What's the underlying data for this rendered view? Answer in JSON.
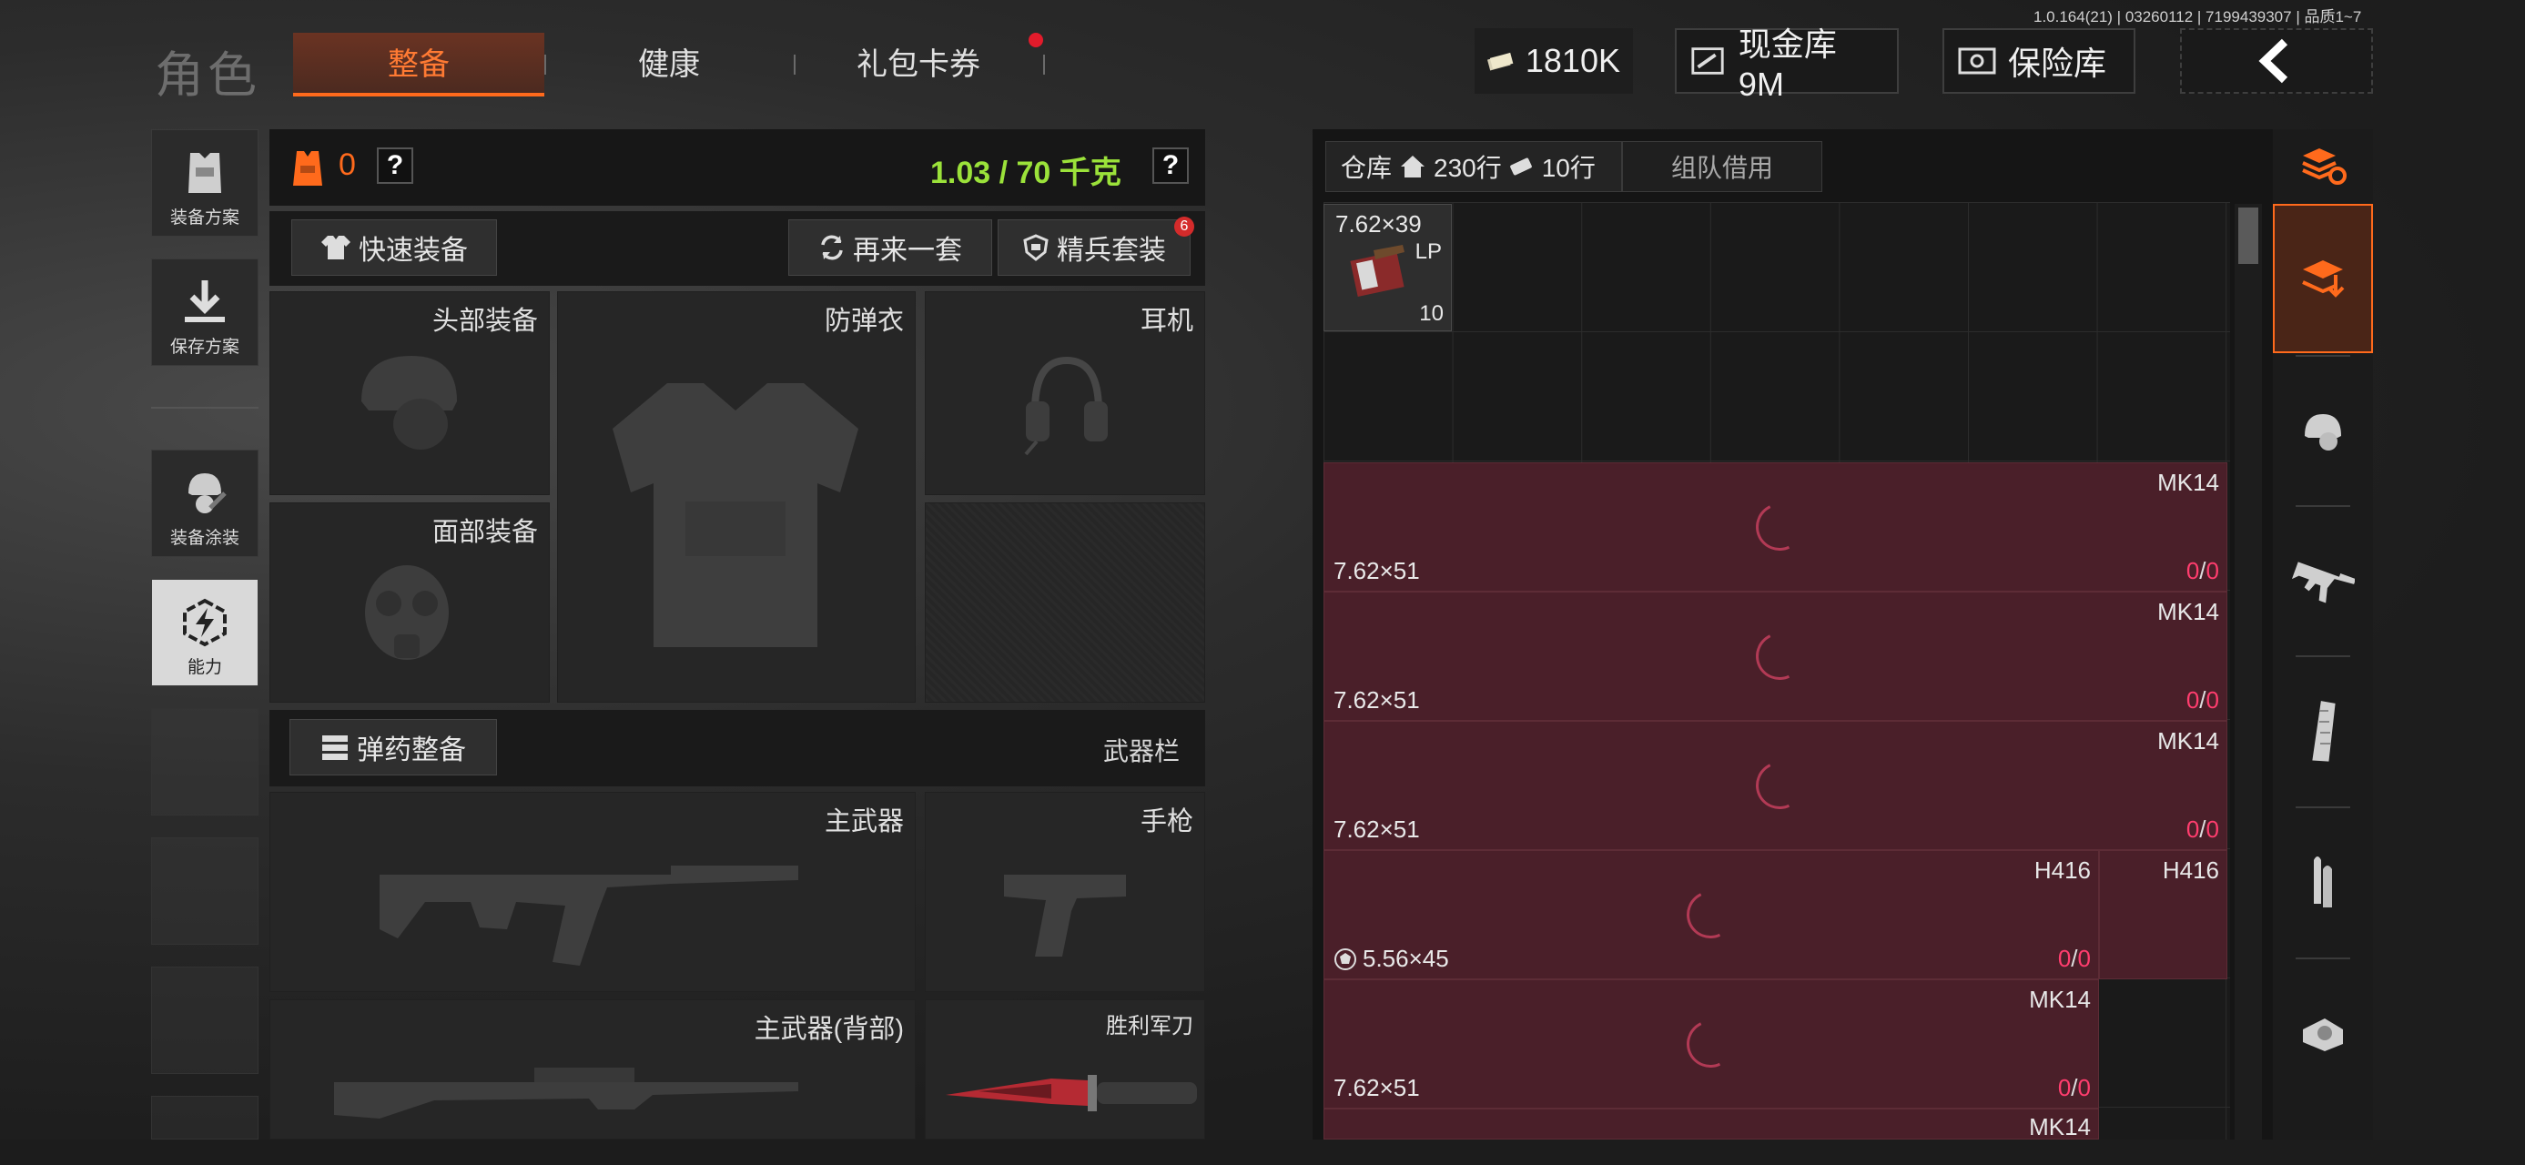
{
  "version": "1.0.164(21) | 03260112 | 7199439307 | 品质1~7",
  "header": {
    "title": "角色",
    "tabs": [
      {
        "label": "整备",
        "active": true
      },
      {
        "label": "健康",
        "active": false
      },
      {
        "label": "礼包卡券",
        "active": false
      }
    ],
    "currency": "1810K",
    "cash_vault": "现金库 9M",
    "safe": "保险库"
  },
  "rail": {
    "plan": "装备方案",
    "save": "保存方案",
    "skin": "装备涂装",
    "ability": "能力"
  },
  "loadout": {
    "count": "0",
    "weight": "1.03 / 70 千克",
    "help": "?",
    "quick_equip": "快速装备",
    "again": "再来一套",
    "elite": "精兵套装",
    "elite_badge": "6",
    "slots": {
      "head": "头部装备",
      "armor": "防弹衣",
      "ear": "耳机",
      "face": "面部装备",
      "primary": "主武器",
      "pistol": "手枪",
      "primary_back": "主武器(背部)",
      "knife": "胜利军刀"
    },
    "ammo_btn": "弹药整备",
    "weapons_bar": "武器栏"
  },
  "warehouse": {
    "tab_label": "仓库",
    "rows": "230行",
    "extra_rows": "10行",
    "team_borrow": "组队借用",
    "item": {
      "caliber": "7.62×39",
      "tag": "LP",
      "qty": "10"
    },
    "weapons": [
      {
        "name": "MK14",
        "caliber": "7.62×51",
        "a": "0",
        "b": "0"
      },
      {
        "name": "MK14",
        "caliber": "7.62×51",
        "a": "0",
        "b": "0"
      },
      {
        "name": "MK14",
        "caliber": "7.62×51",
        "a": "0",
        "b": "0"
      },
      {
        "name": "H416",
        "name2": "H416",
        "caliber": "5.56×45",
        "a": "0",
        "b": "0"
      },
      {
        "name": "MK14",
        "caliber": "7.62×51",
        "a": "0",
        "b": "0"
      },
      {
        "name": "MK14"
      }
    ]
  },
  "colors": {
    "accent": "#ff6a1c",
    "weight_green": "#9be23a",
    "weapon_row": "#4a1f29",
    "count_red": "#ff3d6e"
  }
}
